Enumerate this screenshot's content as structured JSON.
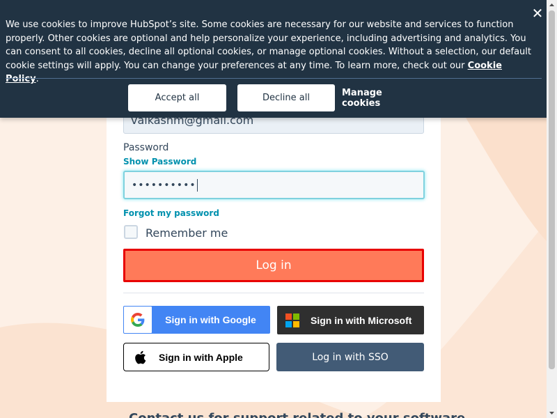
{
  "cookie_banner": {
    "text": "We use cookies to improve HubSpot’s site. Some cookies are necessary for our website and services to function properly. Other cookies are optional and help personalize your experience, including advertising and analytics. You can consent to all cookies, decline all optional cookies, or manage optional cookies. Without a selection, our default cookie settings will apply. You can change your preferences at any time. To learn more, check out our ",
    "policy_link": "Cookie Policy",
    "after_link": ".",
    "close_symbol": "✕",
    "accept_label": "Accept all",
    "decline_label": "Decline all",
    "manage_label": "Manage cookies"
  },
  "login": {
    "email_value": "vaikashm@gmail.com",
    "password_label": "Password",
    "show_password": "Show Password",
    "password_value": "••••••••••",
    "forgot_password": "Forgot my password",
    "remember_me": "Remember me",
    "login_button": "Log in",
    "google_button": "Sign in with Google",
    "microsoft_button": "Sign in with Microsoft",
    "apple_button": "Sign in with Apple",
    "sso_button": "Log in with SSO"
  },
  "footer": {
    "partial_text": "Contact us for support related to your software"
  },
  "colors": {
    "accent": "#ff7a59",
    "banner": "#213343",
    "link": "#0091ae",
    "sso": "#425b76",
    "highlight_border": "#e80000"
  },
  "icons": [
    "close-icon",
    "google-icon",
    "microsoft-icon",
    "apple-icon"
  ]
}
